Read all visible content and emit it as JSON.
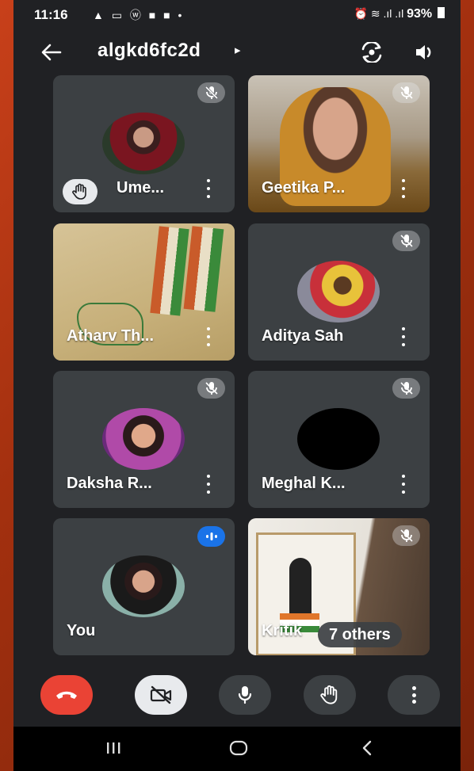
{
  "status_bar": {
    "time": "11:16",
    "left_icons": "▲ ▭ ⓦ ■ ■ •",
    "right_icons": "⏰ ≋ .ıl .ıl",
    "battery": "93%"
  },
  "header": {
    "meeting_code": "algkd6fc2d",
    "caret": "▸"
  },
  "participants": [
    {
      "name": "Ume...",
      "muted": true,
      "hand_raised": true,
      "video": false
    },
    {
      "name": "Geetika P...",
      "muted": true,
      "hand_raised": false,
      "video": true
    },
    {
      "name": "Atharv Th...",
      "muted": false,
      "hand_raised": false,
      "video": true
    },
    {
      "name": "Aditya Sah",
      "muted": true,
      "hand_raised": false,
      "video": false
    },
    {
      "name": "Daksha R...",
      "muted": true,
      "hand_raised": false,
      "video": false
    },
    {
      "name": "Meghal K...",
      "muted": true,
      "hand_raised": false,
      "video": false
    },
    {
      "name": "You",
      "muted": false,
      "speaking": true,
      "video": false
    },
    {
      "name": "Kritik",
      "muted": true,
      "hand_raised": false,
      "video": true,
      "others_label": "7 others"
    }
  ],
  "controls": {
    "end_call_color": "#ea4335",
    "camera_off_color": "#e8eaed",
    "speaking_indicator_color": "#1a73e8"
  },
  "icons": [
    "back-arrow-icon",
    "switch-camera-icon",
    "speaker-icon",
    "mic-off-icon",
    "raise-hand-icon",
    "more-vert-icon",
    "end-call-icon",
    "camera-off-icon",
    "mic-icon",
    "recents-icon",
    "home-icon",
    "nav-back-icon"
  ]
}
